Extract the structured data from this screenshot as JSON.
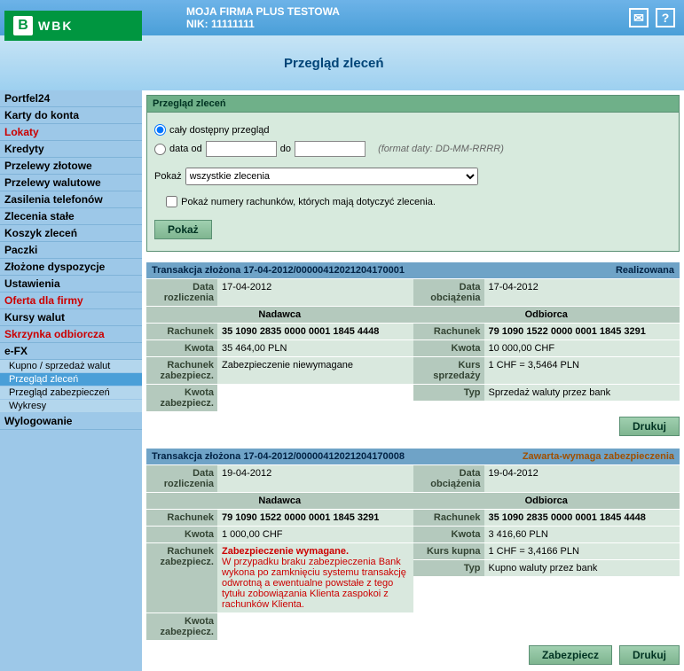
{
  "header": {
    "company": "MOJA FIRMA PLUS TESTOWA",
    "nik_label": "NIK:",
    "nik_value": "11111111"
  },
  "subheader": {
    "title": "Przegląd zleceń"
  },
  "sidebar": {
    "items": [
      {
        "label": "Portfel24"
      },
      {
        "label": "Karty do konta"
      },
      {
        "label": "Lokaty",
        "red": true
      },
      {
        "label": "Kredyty"
      },
      {
        "label": "Przelewy złotowe"
      },
      {
        "label": "Przelewy walutowe"
      },
      {
        "label": "Zasilenia telefonów"
      },
      {
        "label": "Zlecenia stałe"
      },
      {
        "label": "Koszyk zleceń"
      },
      {
        "label": "Paczki"
      },
      {
        "label": "Złożone dyspozycje"
      },
      {
        "label": "Ustawienia"
      },
      {
        "label": "Oferta dla firmy",
        "red": true
      },
      {
        "label": "Kursy walut"
      },
      {
        "label": "Skrzynka odbiorcza",
        "red": true
      },
      {
        "label": "e-FX"
      }
    ],
    "subs": [
      {
        "label": "Kupno / sprzedaż walut"
      },
      {
        "label": "Przegląd zleceń",
        "active": true
      },
      {
        "label": "Przegląd zabezpieczeń"
      },
      {
        "label": "Wykresy"
      }
    ],
    "logout": "Wylogowanie"
  },
  "panel": {
    "title": "Przegląd zleceń",
    "radio_all": "cały dostępny przegląd",
    "radio_range": "data od",
    "do": "do",
    "format_hint": "(format daty: DD-MM-RRRR)",
    "show_label": "Pokaż",
    "select_value": "wszystkie zlecenia",
    "checkbox_label": "Pokaż numery rachunków, których mają dotyczyć zlecenia.",
    "btn_show": "Pokaż"
  },
  "tx": [
    {
      "title": "Transakcja złożona 17-04-2012/00000412021204170001",
      "status": "Realizowana",
      "status_orange": false,
      "nadawca_header": "Nadawca",
      "odbiorca_header": "Odbiorca",
      "left": {
        "data_rozl_l": "Data rozliczenia",
        "data_rozl_v": "17-04-2012",
        "rachunek_l": "Rachunek",
        "rachunek_v": "35 1090 2835 0000 0001 1845 4448",
        "kwota_l": "Kwota",
        "kwota_v": "35 464,00 PLN",
        "rach_zab_l": "Rachunek zabezpiecz.",
        "kwota_zab_l": "Kwota zabezpiecz.",
        "zab_v": "Zabezpieczenie niewymagane"
      },
      "right": {
        "data_obc_l": "Data obciążenia",
        "data_obc_v": "17-04-2012",
        "rachunek_l": "Rachunek",
        "rachunek_v": "79 1090 1522 0000 0001 1845 3291",
        "kwota_l": "Kwota",
        "kwota_v": "10 000,00 CHF",
        "kurs_l": "Kurs sprzedaży",
        "kurs_v": "1 CHF = 3,5464 PLN",
        "typ_l": "Typ",
        "typ_v": "Sprzedaż waluty przez bank"
      },
      "actions": [
        "Drukuj"
      ]
    },
    {
      "title": "Transakcja złożona 17-04-2012/00000412021204170008",
      "status": "Zawarta-wymaga zabezpieczenia",
      "status_orange": true,
      "nadawca_header": "Nadawca",
      "odbiorca_header": "Odbiorca",
      "left": {
        "data_rozl_l": "Data rozliczenia",
        "data_rozl_v": "19-04-2012",
        "rachunek_l": "Rachunek",
        "rachunek_v": "79 1090 1522 0000 0001 1845 3291",
        "kwota_l": "Kwota",
        "kwota_v": "1 000,00 CHF",
        "rach_zab_l": "Rachunek zabezpiecz.",
        "kwota_zab_l": "Kwota zabezpiecz.",
        "zab_title": "Zabezpieczenie wymagane.",
        "zab_v": "W przypadku braku zabezpieczenia Bank wykona po zamknięciu systemu transakcję odwrotną a ewentualne powstałe z tego tytułu zobowiązania Klienta zaspokoi z rachunków Klienta."
      },
      "right": {
        "data_obc_l": "Data obciążenia",
        "data_obc_v": "19-04-2012",
        "rachunek_l": "Rachunek",
        "rachunek_v": "35 1090 2835 0000 0001 1845 4448",
        "kwota_l": "Kwota",
        "kwota_v": "3 416,60 PLN",
        "kurs_l": "Kurs kupna",
        "kurs_v": "1 CHF = 3,4166 PLN",
        "typ_l": "Typ",
        "typ_v": "Kupno waluty przez bank"
      },
      "actions": [
        "Zabezpiecz",
        "Drukuj"
      ]
    }
  ],
  "logo": "WBK"
}
